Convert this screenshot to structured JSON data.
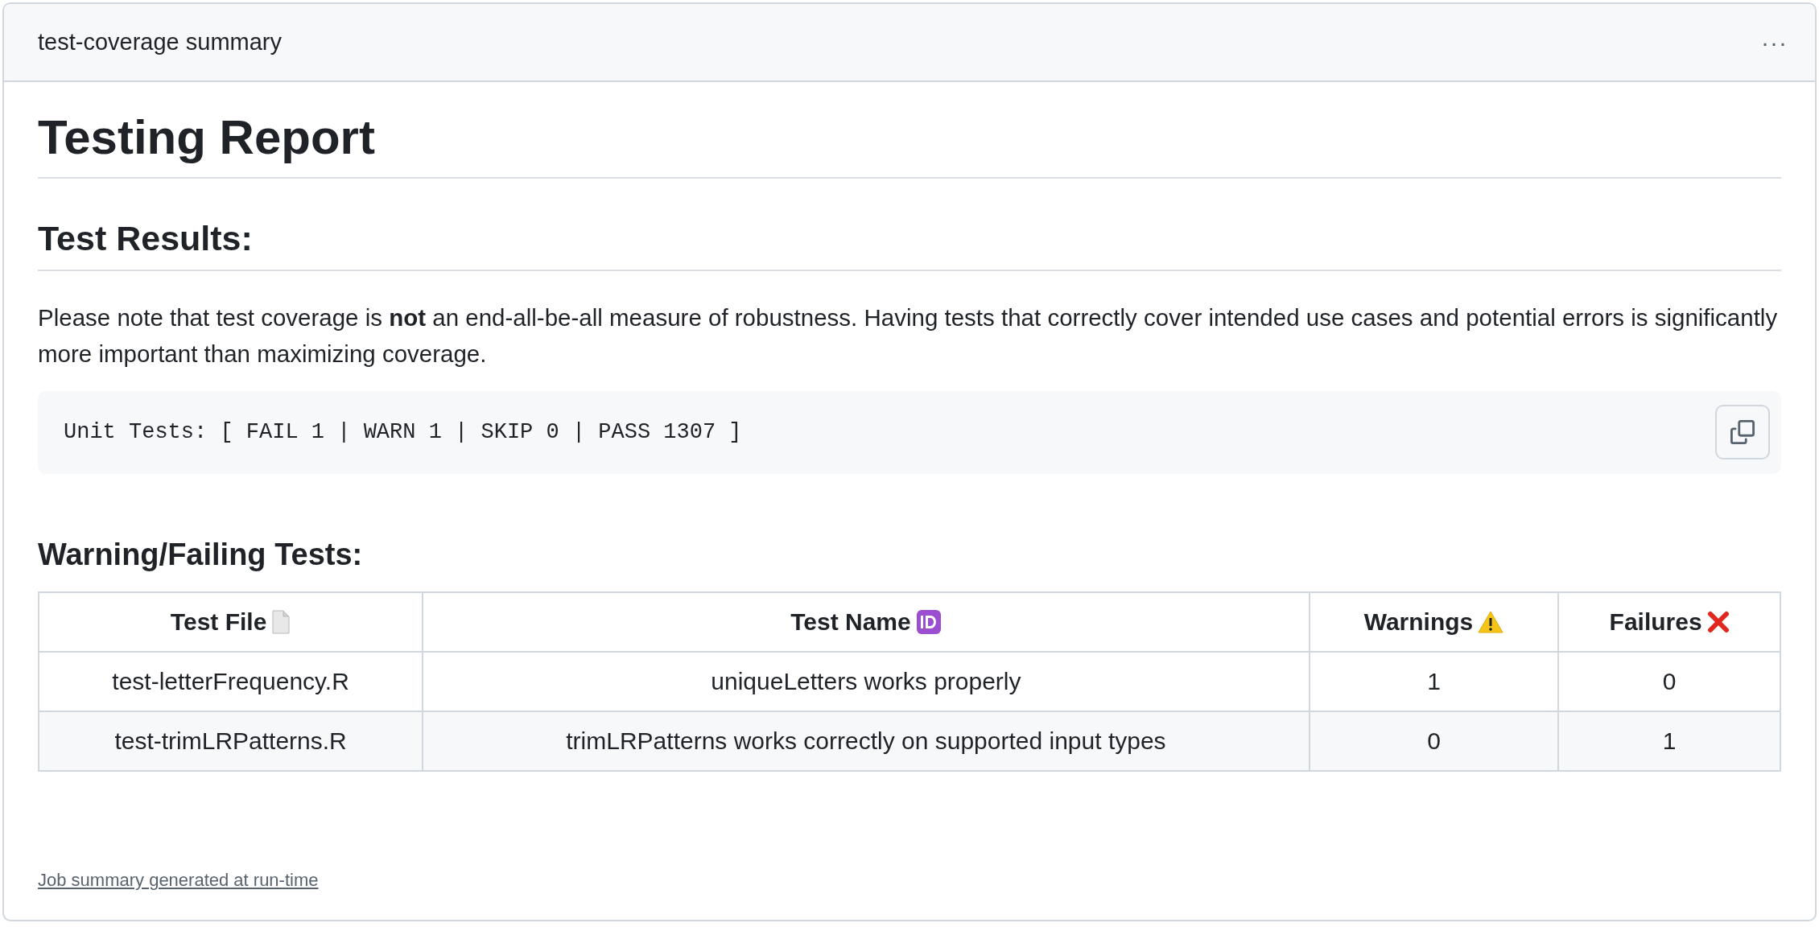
{
  "header": {
    "title": "test-coverage summary",
    "menu": "···"
  },
  "report": {
    "title": "Testing Report",
    "section": "Test Results:",
    "note": "Please note that test coverage is **not** an end-all-be-all measure of robustness. Having tests that correctly cover intended use cases and potential errors is significantly more important than maximizing coverage.",
    "code": "Unit Tests: [ FAIL 1 | WARN 1 | SKIP 0 | PASS 1307 ]"
  },
  "failing": {
    "title": "Warning/Failing Tests:",
    "columns": [
      {
        "label": "Test File",
        "kind": "file"
      },
      {
        "label": "Test Name",
        "kind": "id"
      },
      {
        "label": "Warnings",
        "kind": "warning"
      },
      {
        "label": "Failures",
        "kind": "cross"
      }
    ],
    "rows": [
      [
        "test-letterFrequency.R",
        "uniqueLetters works properly",
        "1",
        "0"
      ],
      [
        "test-trimLRPatterns.R",
        "trimLRPatterns works correctly on supported input types",
        "0",
        "1"
      ]
    ]
  },
  "footer": "Job summary generated at run-time"
}
